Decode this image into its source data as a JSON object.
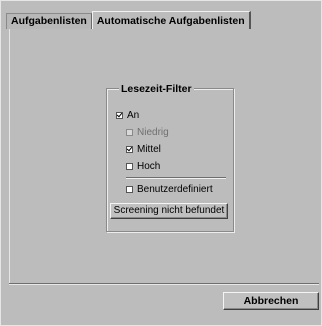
{
  "tabs": [
    {
      "label": "Aufgabenlisten",
      "active": false
    },
    {
      "label": "Automatische Aufgabenlisten",
      "active": true
    }
  ],
  "filter_group": {
    "title": "Lesezeit-Filter",
    "items": [
      {
        "label": "An",
        "checked": true,
        "enabled": true
      },
      {
        "label": "Niedrig",
        "checked": false,
        "enabled": false
      },
      {
        "label": "Mittel",
        "checked": true,
        "enabled": true
      },
      {
        "label": "Hoch",
        "checked": false,
        "enabled": true
      },
      {
        "label": "Benutzerdefiniert",
        "checked": false,
        "enabled": true
      }
    ],
    "button_label": "Screening nicht befundet"
  },
  "footer": {
    "cancel_label": "Abbrechen"
  }
}
